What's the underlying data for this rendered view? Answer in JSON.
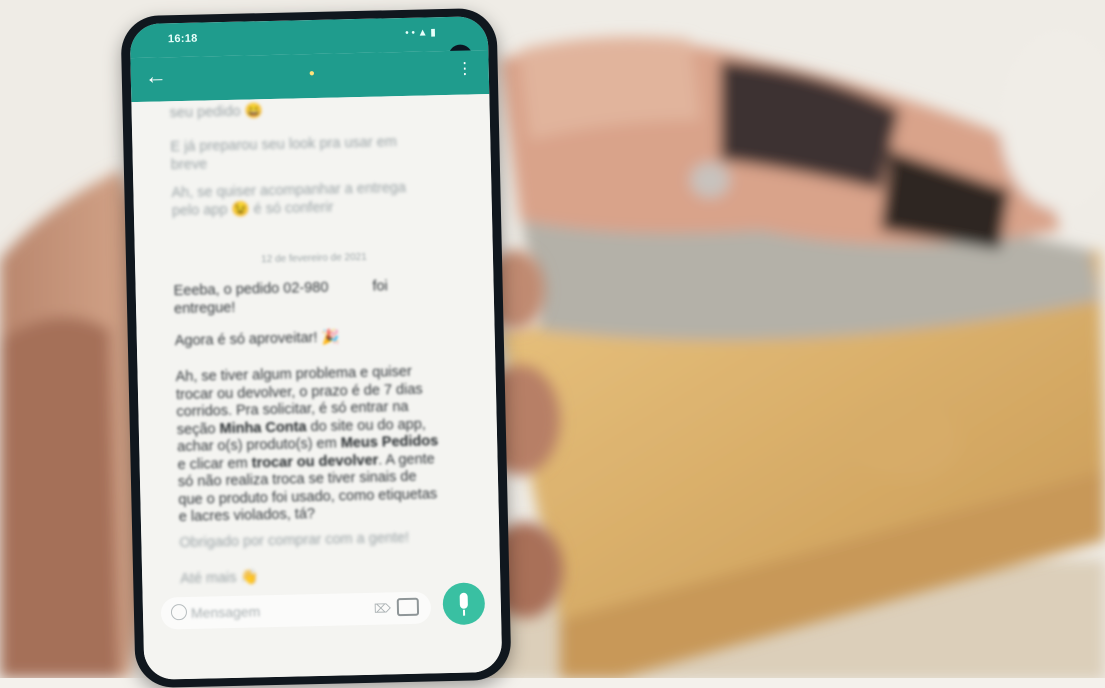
{
  "status_bar": {
    "time": "16:18",
    "icons": "• • ▲ ▮"
  },
  "header": {
    "emoji": "●",
    "back_icon": "arrow-left-icon",
    "menu_icon": "more-vert-icon"
  },
  "chat": {
    "prev_msg_1": "seu pedido 😀",
    "prev_msg_2": "E já preparou seu look pra usar em breve",
    "prev_msg_3": "Ah, se quiser acompanhar a entrega pelo app 😉 é só conferir",
    "date_separator": "12 de fevereiro de 2021",
    "msg_delivered_1": "Eeeba, o pedido 02-980",
    "msg_delivered_fill": "foi",
    "msg_delivered_2": "entregue!",
    "msg_enjoy": "Agora é só aproveitar! 🎉",
    "msg_policy_1": "Ah, se tiver algum problema e quiser trocar ou devolver, o prazo é de 7 dias corridos. Pra solicitar, é só entrar na seção",
    "msg_policy_bold_1": "Minha Conta",
    "msg_policy_2": "do site ou do app, achar o(s) produto(s) em",
    "msg_policy_bold_2": "Meus Pedidos",
    "msg_policy_3": "e clicar em",
    "msg_policy_bold_3": "trocar ou devolver",
    "msg_policy_4": ". A gente só não realiza troca se tiver sinais de que o produto foi usado, como etiquetas e lacres violados, tá?",
    "msg_thanks": "Obrigado por comprar com a gente!",
    "msg_bye": "Até mais 👋"
  },
  "input": {
    "placeholder": "Mensagem"
  },
  "colors": {
    "header": "#1f9c8d",
    "mic": "#39c0a2",
    "chat_bg": "#f4f4f1"
  }
}
